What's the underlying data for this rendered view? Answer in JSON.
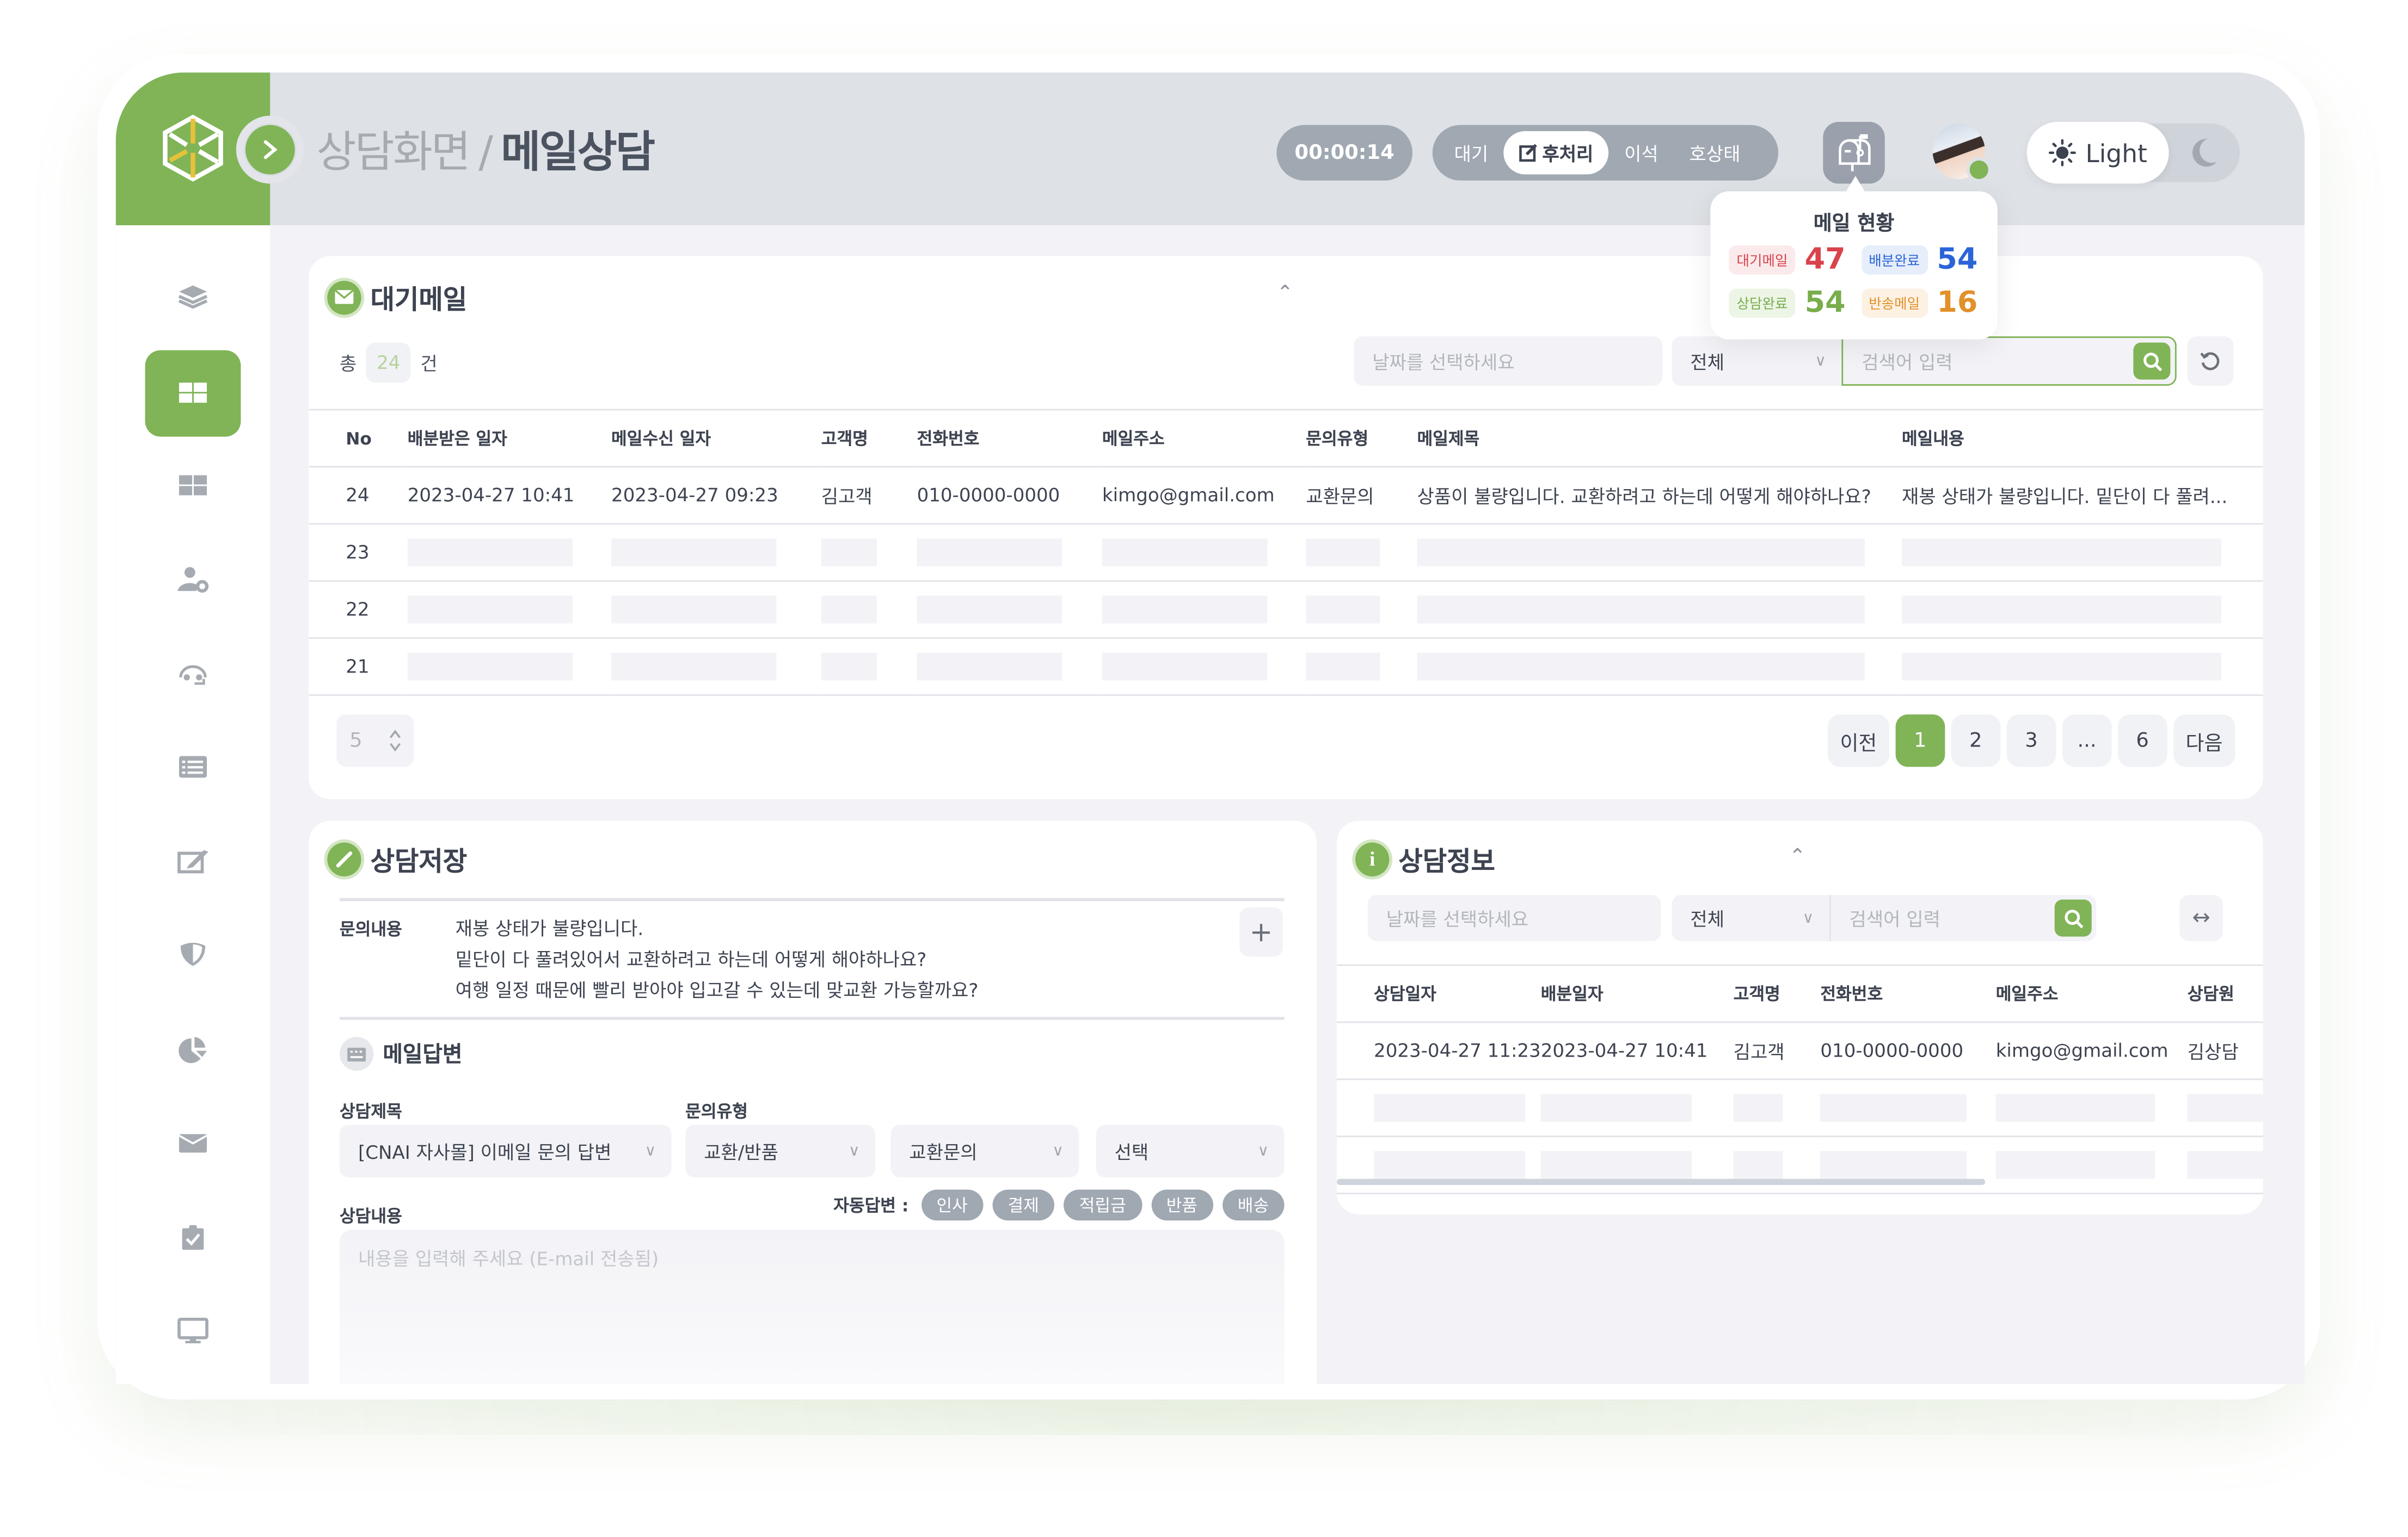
{
  "header": {
    "breadcrumb_parent": "상담화면",
    "breadcrumb_sep": "/",
    "page_title": "메일상담",
    "timer": "00:00:14",
    "status_options": [
      {
        "label": "대기",
        "active": false
      },
      {
        "label": "후처리",
        "active": true
      },
      {
        "label": "이석",
        "active": false
      },
      {
        "label": "호상태",
        "active": false
      }
    ],
    "theme_light_label": "Light",
    "user_status": "online"
  },
  "mail_status_popover": {
    "title": "메일 현황",
    "items": [
      {
        "label": "대기메일",
        "value": "47",
        "color": "#d9434b",
        "bg": "#fbeaec"
      },
      {
        "label": "배분완료",
        "value": "54",
        "color": "#2a64d8",
        "bg": "#e6eefb"
      },
      {
        "label": "상담완료",
        "value": "54",
        "color": "#78ad4c",
        "bg": "#edf5e6"
      },
      {
        "label": "반송메일",
        "value": "16",
        "color": "#e2902a",
        "bg": "#fcf1e3"
      }
    ]
  },
  "sidebar": {
    "items": [
      {
        "icon": "layers-icon",
        "active": false
      },
      {
        "icon": "dashboard-icon",
        "active": true
      },
      {
        "icon": "grid-icon",
        "active": false
      },
      {
        "icon": "user-settings-icon",
        "active": false
      },
      {
        "icon": "headset-icon",
        "active": false
      },
      {
        "icon": "list-icon",
        "active": false
      },
      {
        "icon": "edit-icon",
        "active": false
      },
      {
        "icon": "shield-icon",
        "active": false
      },
      {
        "icon": "pie-chart-icon",
        "active": false
      },
      {
        "icon": "mail-icon",
        "active": false
      },
      {
        "icon": "clipboard-check-icon",
        "active": false
      },
      {
        "icon": "monitor-icon",
        "active": false
      }
    ]
  },
  "waiting_mail": {
    "title": "대기메일",
    "count_prefix": "총",
    "count": "24",
    "count_suffix": "건",
    "date_placeholder": "날짜를 선택하세요",
    "filter_value": "전체",
    "search_placeholder": "검색어 입력",
    "columns": [
      "No",
      "배분받은 일자",
      "메일수신 일자",
      "고객명",
      "전화번호",
      "메일주소",
      "문의유형",
      "메일제목",
      "메일내용"
    ],
    "rows": [
      {
        "no": "24",
        "assigned": "2023-04-27 10:41",
        "received": "2023-04-27 09:23",
        "name": "김고객",
        "phone": "010-0000-0000",
        "email": "kimgo@gmail.com",
        "type": "교환문의",
        "subject": "상품이 불량입니다. 교환하려고 하는데 어떻게 해야하나요?",
        "content": "재봉 상태가 불량입니다. 밑단이 다 풀려..."
      },
      {
        "no": "23",
        "placeholder": true
      },
      {
        "no": "22",
        "placeholder": true
      },
      {
        "no": "21",
        "placeholder": true
      }
    ],
    "page_size": "5",
    "pagination": {
      "prev": "이전",
      "pages": [
        "1",
        "2",
        "3",
        "...",
        "6"
      ],
      "current": "1",
      "next": "다음"
    }
  },
  "consult_save": {
    "title": "상담저장",
    "inquiry_label": "문의내용",
    "inquiry_lines": [
      "재봉 상태가 불량입니다.",
      "밑단이 다 풀려있어서 교환하려고 하는데 어떻게 해야하나요?",
      "여행 일정 때문에 빨리 받아야 입고갈 수 있는데 맞교환 가능할까요?"
    ],
    "reply_title": "메일답변",
    "subject_label": "상담제목",
    "subject_value": "[CNAI 자사몰] 이메일 문의 답변",
    "type_label": "문의유형",
    "type_values": [
      "교환/반품",
      "교환문의",
      "선택"
    ],
    "content_label": "상담내용",
    "auto_reply_label": "자동답변 :",
    "auto_replies": [
      "인사",
      "결제",
      "적립금",
      "반품",
      "배송"
    ],
    "content_placeholder": "내용을 입력해 주세요 (E-mail 전송됨)"
  },
  "consult_info": {
    "title": "상담정보",
    "date_placeholder": "날짜를 선택하세요",
    "filter_value": "전체",
    "search_placeholder": "검색어 입력",
    "columns": [
      "상담일자",
      "배분일자",
      "고객명",
      "전화번호",
      "메일주소",
      "상담원"
    ],
    "rows": [
      {
        "consulted": "2023-04-27 11:23",
        "assigned": "2023-04-27 10:41",
        "name": "김고객",
        "phone": "010-0000-0000",
        "email": "kimgo@gmail.com",
        "agent": "김상담"
      },
      {
        "placeholder": true
      },
      {
        "placeholder": true
      }
    ]
  }
}
